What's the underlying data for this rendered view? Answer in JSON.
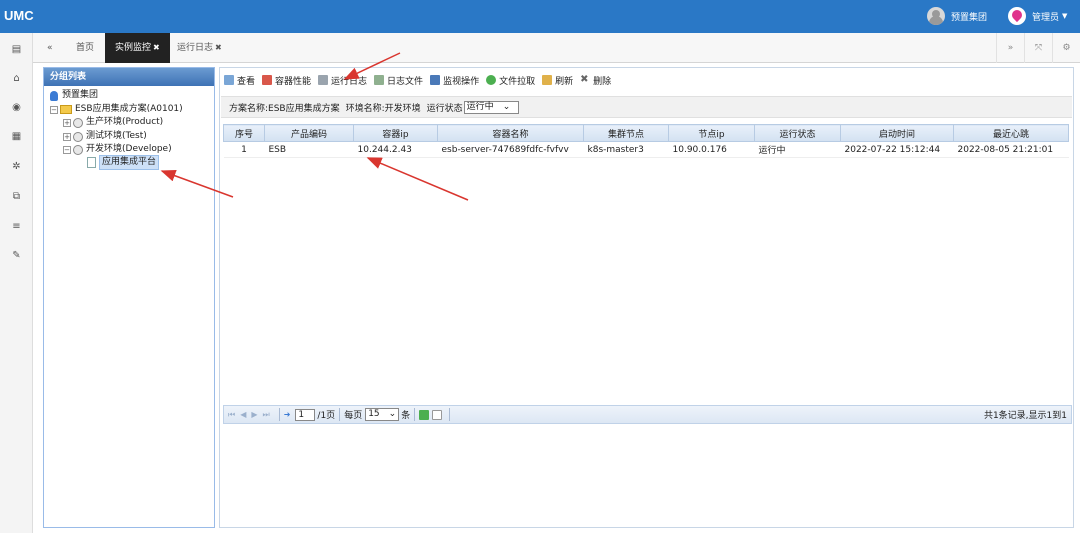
{
  "app": {
    "title": "UMC"
  },
  "header": {
    "group_label": "预置集团",
    "user_label": "管理员"
  },
  "tabs": [
    {
      "label": "首页"
    },
    {
      "label": "实例监控"
    },
    {
      "label": "运行日志"
    }
  ],
  "rail_icons": [
    "card-icon",
    "bank-icon",
    "eye-icon",
    "list-icon",
    "gear-icon",
    "sitemap-icon",
    "menu-icon",
    "wrench-icon"
  ],
  "group_panel": {
    "title": "分组列表",
    "tree": {
      "root": "预置集团",
      "solution": "ESB应用集成方案(A0101)",
      "env_product": "生产环境(Product)",
      "env_test": "测试环境(Test)",
      "env_develop": "开发环境(Develope)",
      "app_node": "应用集成平台"
    }
  },
  "toolbar": {
    "view": "查看",
    "perf": "容器性能",
    "runlog": "运行日志",
    "logfile": "日志文件",
    "monitor": "监视操作",
    "pull": "文件拉取",
    "refresh": "刷新",
    "delete": "删除"
  },
  "info": {
    "plan": "方案名称:ESB应用集成方案",
    "env": "环境名称:开发环境",
    "status_label": "运行状态",
    "status_value": "运行中"
  },
  "grid": {
    "columns": [
      "序号",
      "产品编码",
      "容器ip",
      "容器名称",
      "集群节点",
      "节点ip",
      "运行状态",
      "启动时间",
      "最近心跳"
    ],
    "rows": [
      [
        "1",
        "ESB",
        "10.244.2.43",
        "esb-server-747689fdfc-fvfvv",
        "k8s-master3",
        "10.90.0.176",
        "运行中",
        "2022-07-22 15:12:44",
        "2022-08-05 21:21:01"
      ]
    ]
  },
  "pager": {
    "page_value": "1",
    "page_total": "/1页",
    "per_page_label": "每页",
    "per_page_value": "15",
    "per_page_unit": "条",
    "summary": "共1条记录,显示1到1"
  }
}
